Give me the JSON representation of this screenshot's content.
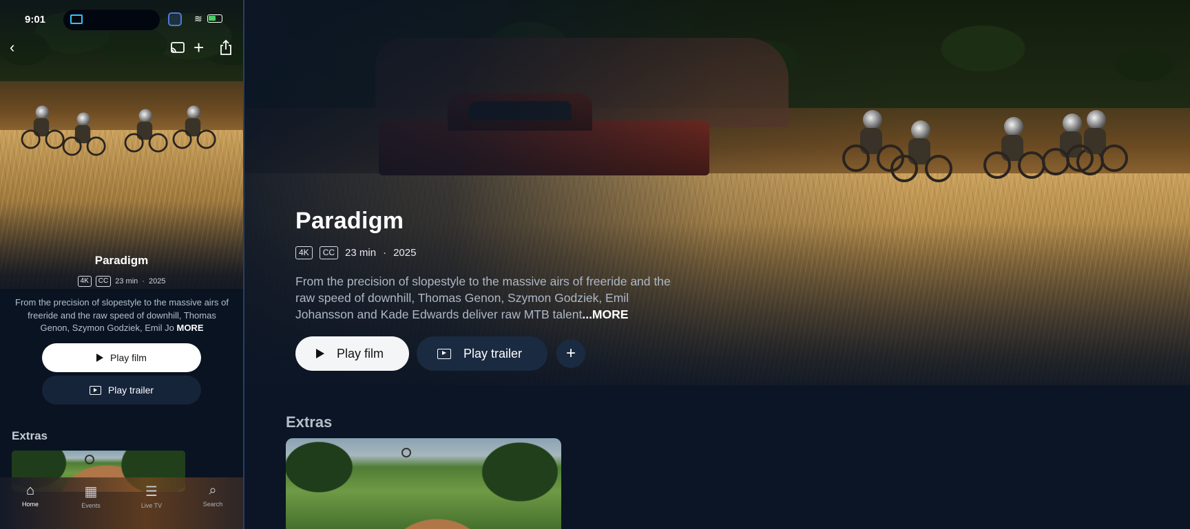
{
  "phone": {
    "status_bar": {
      "time": "9:01"
    },
    "title": "Paradigm",
    "meta": {
      "badge_4k": "4K",
      "badge_cc": "CC",
      "duration": "23 min",
      "separator": "·",
      "year": "2025"
    },
    "description": "From the precision of slopestyle to the massive airs of freeride and the raw speed of downhill, Thomas Genon, Szymon Godziek, Emil Jo",
    "more_label": "MORE",
    "play_film_label": "Play film",
    "play_trailer_label": "Play trailer",
    "extras_heading": "Extras",
    "tabs": [
      {
        "label": "Home",
        "icon": "home-icon"
      },
      {
        "label": "Events",
        "icon": "calendar-icon"
      },
      {
        "label": "Live TV",
        "icon": "list-icon"
      },
      {
        "label": "Search",
        "icon": "search-icon"
      }
    ]
  },
  "tablet": {
    "title": "Paradigm",
    "meta": {
      "badge_4k": "4K",
      "badge_cc": "CC",
      "duration": "23 min",
      "separator": "·",
      "year": "2025"
    },
    "description": "From the precision of slopestyle to the massive airs of freeride and the raw speed of downhill, Thomas Genon, Szymon Godziek, Emil Johansson and Kade Edwards deliver raw MTB talent",
    "more_label": "...MORE",
    "play_film_label": "Play film",
    "play_trailer_label": "Play trailer",
    "add_label": "+",
    "extras_heading": "Extras"
  },
  "colors": {
    "background": "#0b1526",
    "primary_button": "#f4f5f7",
    "secondary_button": "#1a2a40",
    "accent_airplay": "#36c3ff"
  }
}
